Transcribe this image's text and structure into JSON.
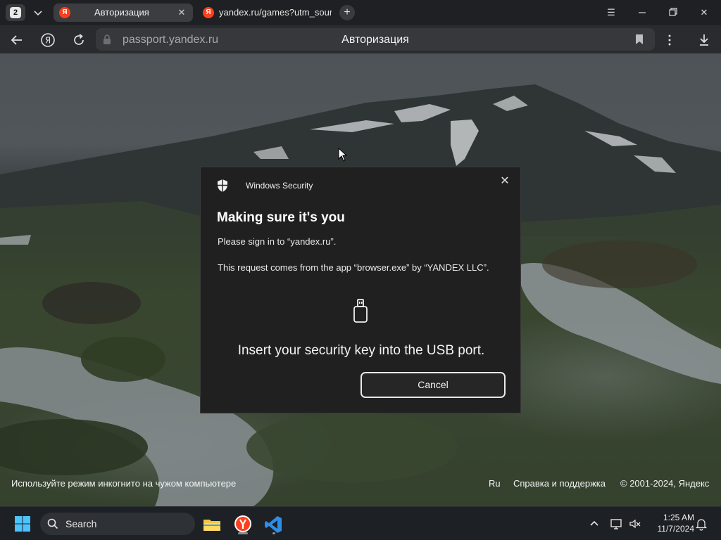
{
  "browser": {
    "tab_count": "2",
    "tabs": [
      {
        "label": "Авторизация",
        "favicon": "Я",
        "active": true
      },
      {
        "label": "yandex.ru/games?utm_source=",
        "favicon": "Я",
        "active": false
      }
    ],
    "omnibox": {
      "url": "passport.yandex.ru",
      "page_title": "Авторизация"
    }
  },
  "page": {
    "footer": {
      "incognito_hint": "Используйте режим инкогнито на чужом компьютере",
      "language": "Ru",
      "help": "Справка и поддержка",
      "copyright": "© 2001-2024, Яндекс"
    }
  },
  "dialog": {
    "app_name": "Windows Security",
    "heading": "Making sure it's you",
    "line1": "Please sign in to “yandex.ru”.",
    "line2": "This request comes from the app “browser.exe” by “YANDEX LLC”.",
    "instruction": "Insert your security key into the USB port.",
    "cancel_label": "Cancel"
  },
  "taskbar": {
    "search_label": "Search",
    "apps": [
      "file-explorer",
      "yandex-browser",
      "visual-studio-code"
    ],
    "time": "1:25 AM",
    "date": "11/7/2024"
  },
  "colors": {
    "yandex_red": "#fc3f1d",
    "dialog_bg": "#202020",
    "vscode_blue": "#2c8ee8",
    "explorer_yellow": "#f2c53d"
  }
}
